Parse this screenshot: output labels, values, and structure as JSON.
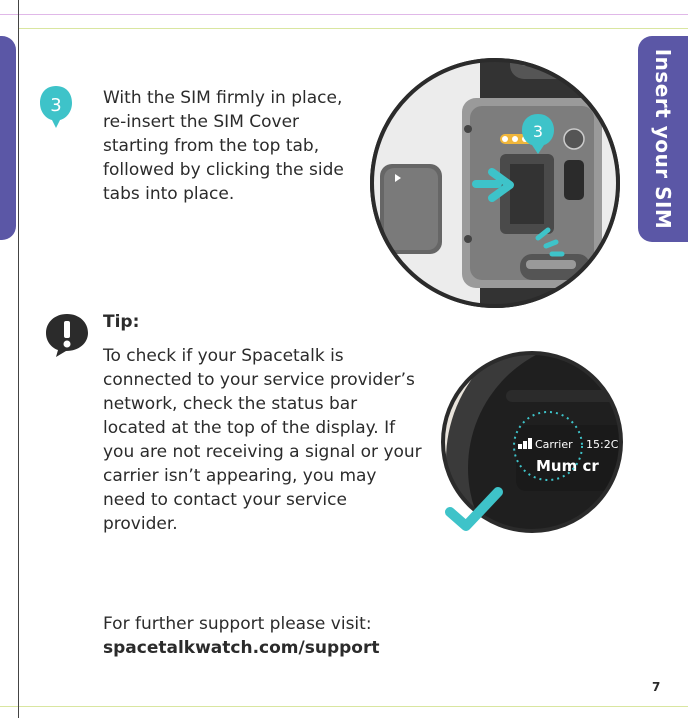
{
  "side_tab": {
    "label": "Insert your SIM"
  },
  "step": {
    "number": "3",
    "text": "With the SIM firmly in place, re-insert the SIM Cover starting from the top tab, followed by clicking the side tabs into place."
  },
  "figure1": {
    "badge": "3"
  },
  "tip": {
    "title": "Tip:",
    "text": "To check if your Spacetalk is connected to your service provider’s network, check the status bar located at the top of the display. If you are not receiving a signal or your carrier isn’t appearing, you may need to contact your service provider."
  },
  "figure2": {
    "carrier": "Carrier",
    "time": "15:2C",
    "contact": "Mum cr"
  },
  "support": {
    "lead": "For further support please visit:",
    "url": "spacetalkwatch.com/support"
  },
  "page": {
    "number": "7"
  },
  "colors": {
    "tab_purple": "#5b57a6",
    "teal": "#3ec3c9",
    "dark": "#2b2b2b"
  }
}
